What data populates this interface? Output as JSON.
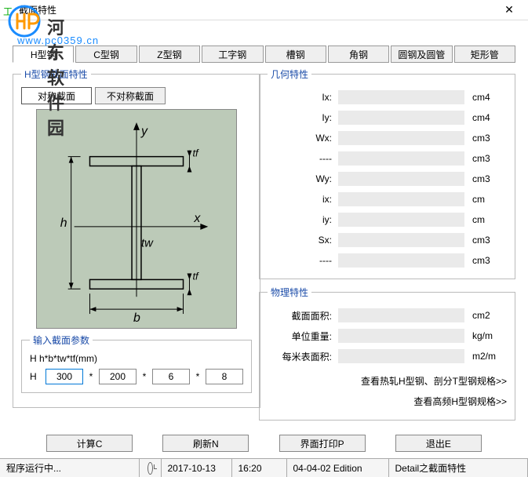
{
  "window": {
    "title": "截面特性"
  },
  "watermark": {
    "name": "河东软件园",
    "url": "www.pc0359.cn"
  },
  "tabs": [
    "H型钢",
    "C型钢",
    "Z型钢",
    "工字钢",
    "槽钢",
    "角钢",
    "圆钢及圆管",
    "矩形管"
  ],
  "section": {
    "legend": "H型钢截面特性",
    "sym_tabs": [
      "对称截面",
      "不对称截面"
    ],
    "input_legend": "输入截面参数",
    "formula": "H  h*b*tw*tf(mm)",
    "param_label": "H",
    "params": [
      "300",
      "200",
      "6",
      "8"
    ]
  },
  "geom": {
    "legend": "几何特性",
    "rows": [
      {
        "k": "Ix:",
        "u": "cm4"
      },
      {
        "k": "Iy:",
        "u": "cm4"
      },
      {
        "k": "Wx:",
        "u": "cm3"
      },
      {
        "k": "----",
        "u": "cm3"
      },
      {
        "k": "Wy:",
        "u": "cm3"
      },
      {
        "k": "ix:",
        "u": "cm"
      },
      {
        "k": "iy:",
        "u": "cm"
      },
      {
        "k": "Sx:",
        "u": "cm3"
      },
      {
        "k": "----",
        "u": "cm3"
      }
    ]
  },
  "phys": {
    "legend": "物理特性",
    "rows": [
      {
        "k": "截面面积:",
        "u": "cm2"
      },
      {
        "k": "单位重量:",
        "u": "kg/m"
      },
      {
        "k": "每米表面积:",
        "u": "m2/m"
      }
    ],
    "link1": "查看热轧H型钢、剖分T型钢规格>>",
    "link2": "查看高频H型钢规格>>"
  },
  "buttons": {
    "calc": "计算C",
    "refresh": "刷新N",
    "print": "界面打印P",
    "exit": "退出E"
  },
  "status": {
    "running": "程序运行中...",
    "date": "2017-10-13",
    "time": "16:20",
    "edition": "04-04-02 Edition",
    "detail": "Detail之截面特性"
  },
  "diagram_labels": {
    "y": "y",
    "x": "x",
    "h": "h",
    "b": "b",
    "tw": "tw",
    "tf1": "tf",
    "tf2": "tf"
  }
}
